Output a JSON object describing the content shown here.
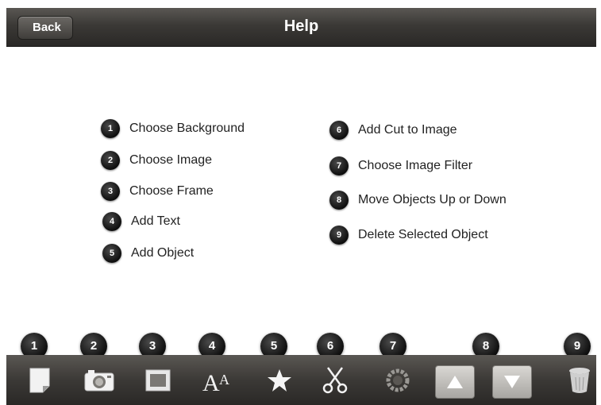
{
  "header": {
    "back_label": "Back",
    "title": "Help"
  },
  "help_left": [
    {
      "num": "1",
      "label": "Choose Background"
    },
    {
      "num": "2",
      "label": "Choose Image"
    },
    {
      "num": "3",
      "label": "Choose Frame"
    },
    {
      "num": "4",
      "label": "Add Text"
    },
    {
      "num": "5",
      "label": "Add Object"
    }
  ],
  "help_right": [
    {
      "num": "6",
      "label": "Add Cut to Image"
    },
    {
      "num": "7",
      "label": "Choose Image Filter"
    },
    {
      "num": "8",
      "label": "Move Objects Up or Down"
    },
    {
      "num": "9",
      "label": "Delete Selected Object"
    }
  ],
  "toolbar": {
    "badges": [
      "1",
      "2",
      "3",
      "4",
      "5",
      "6",
      "7",
      "8",
      "9"
    ],
    "tools": [
      {
        "icon": "page-icon"
      },
      {
        "icon": "camera-icon"
      },
      {
        "icon": "frame-icon"
      },
      {
        "icon": "text-icon",
        "glyph": "AA"
      },
      {
        "icon": "star-icon"
      },
      {
        "icon": "scissors-icon"
      },
      {
        "icon": "filter-icon"
      },
      {
        "icon": "arrow-up-icon"
      },
      {
        "icon": "arrow-down-icon"
      },
      {
        "icon": "trash-icon"
      }
    ]
  },
  "colors": {
    "bar_dark": "#2a2826",
    "badge": "#0e0e0e",
    "text": "#222222"
  }
}
